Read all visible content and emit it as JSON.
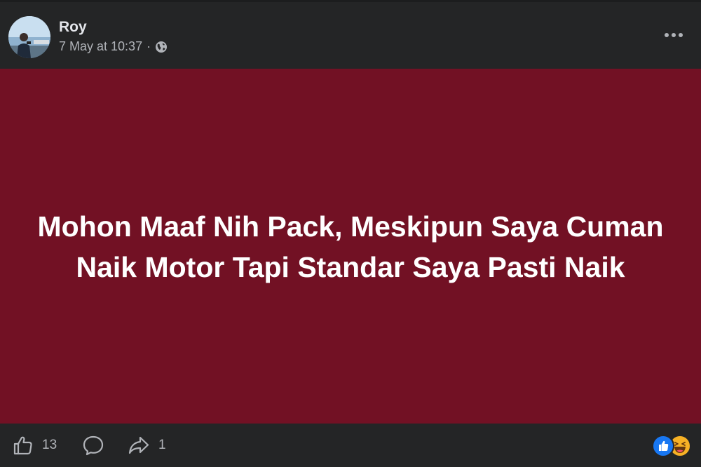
{
  "post": {
    "author": "Roy",
    "timestamp": "7 May at 10:37",
    "separator": "·",
    "privacy_icon": "globe-icon",
    "more_icon": "more-options-icon"
  },
  "content": {
    "background_color": "#721124",
    "text": "Mohon Maaf Nih Pack, Meskipun Saya Cuman Naik Motor Tapi Standar Saya Pasti Naik"
  },
  "footer": {
    "like_icon": "thumbs-up-icon",
    "like_count": "13",
    "comment_icon": "comment-icon",
    "share_icon": "share-icon",
    "share_count": "1",
    "reactions": [
      "like-reaction-icon",
      "haha-reaction-icon"
    ]
  },
  "colors": {
    "background": "#242526",
    "text_primary": "#e4e6eb",
    "text_secondary": "#b0b3b8",
    "like_blue": "#1877f2",
    "haha_yellow": "#f7b125"
  }
}
